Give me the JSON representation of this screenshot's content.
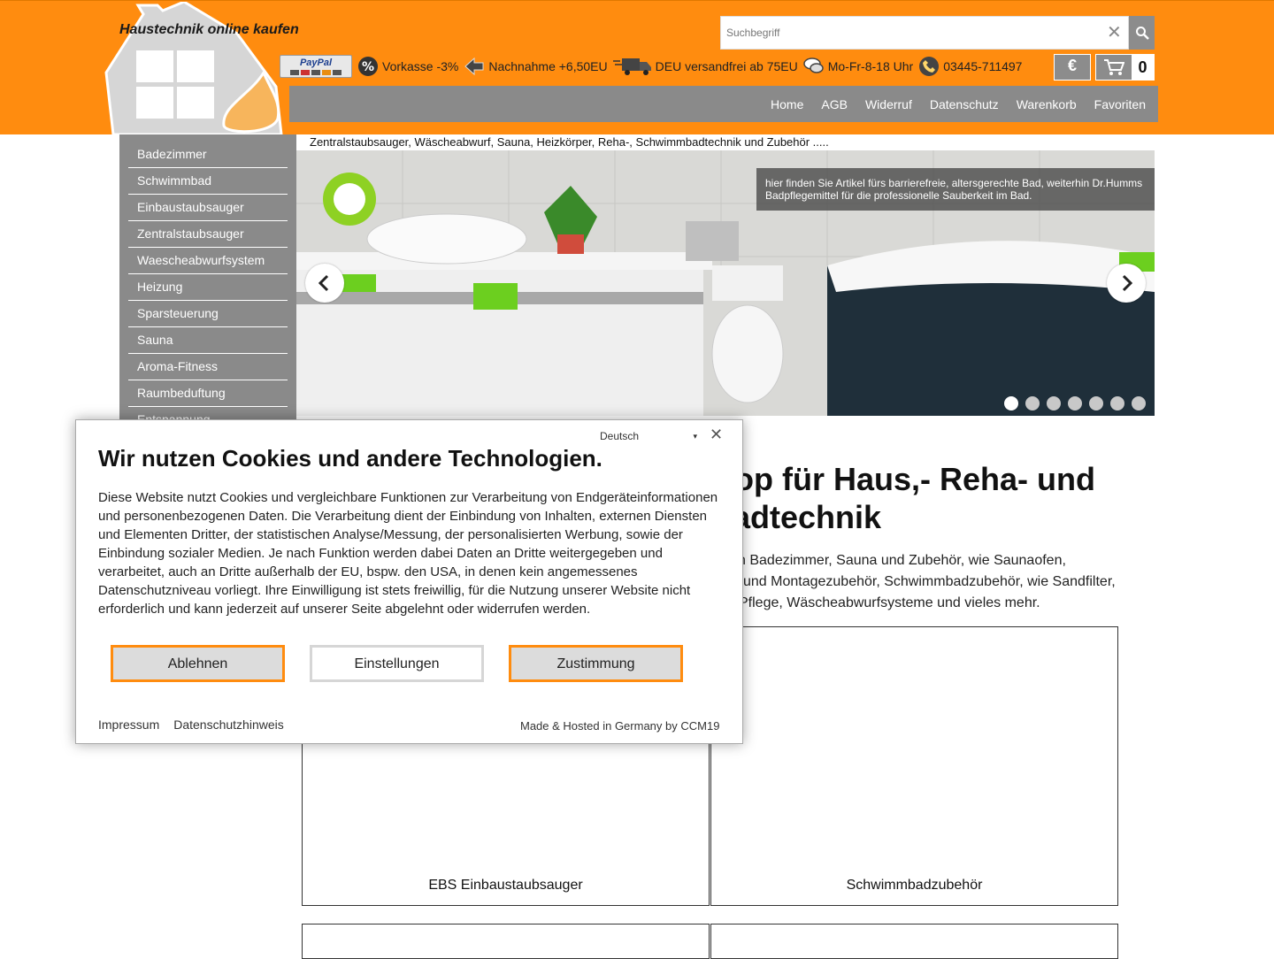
{
  "header": {
    "tagline": "Haustechnik online kaufen",
    "search": {
      "placeholder": "Suchbegriff",
      "value": ""
    },
    "info": [
      {
        "icon": "paypal-logo",
        "text": ""
      },
      {
        "icon": "percent-icon",
        "text": "Vorkasse -3%"
      },
      {
        "icon": "arrow-icon",
        "text": "Nachnahme +6,50EU"
      },
      {
        "icon": "truck-icon",
        "text": "DEU versandfrei ab 75EU"
      },
      {
        "icon": "speech-icon",
        "text": "Mo-Fr-8-18 Uhr"
      },
      {
        "icon": "phone-icon",
        "text": "03445-711497"
      }
    ],
    "paypal_label": "PayPal",
    "currency": "€",
    "cart_count": "0"
  },
  "nav": [
    "Home",
    "AGB",
    "Widerruf",
    "Datenschutz",
    "Warenkorb",
    "Favoriten"
  ],
  "sidebar": [
    "Badezimmer",
    "Schwimmbad",
    "Einbaustaubsauger",
    "Zentralstaubsauger",
    "Waescheabwurfsystem",
    "Heizung",
    "Sparsteuerung",
    "Sauna",
    "Aroma-Fitness",
    "Raumbeduftung",
    "Entspannung"
  ],
  "slogan": "Zentralstaubsauger, Wäscheabwurf, Sauna, Heizkörper, Reha-, Schwimmbadtechnik und Zubehör .....",
  "slider": {
    "caption": "hier finden Sie Artikel fürs barrierefreie, altersgerechte Bad, weiterhin Dr.Humms Badpflegemittel für die professionelle Sauberkeit im Bad.",
    "dot_count": 7,
    "active_dot": 1
  },
  "main": {
    "heading_visible": "op für Haus,- Reha- und adtechnik",
    "heading_line1": "op für Haus,- Reha- und",
    "heading_line2": "adtechnik",
    "intro_line1": "n Badezimmer, Sauna und Zubehör, wie Saunaofen,",
    "intro_line2": "und Montagezubehör, Schwimmbadzubehör, wie Sandfilter,",
    "intro_line3": "Pflege, Wäscheabwurfsysteme und vieles mehr.",
    "products": [
      "EBS Einbaustaubsauger",
      "Schwimmbadzubehör"
    ]
  },
  "cookie": {
    "language": "Deutsch",
    "title": "Wir nutzen Cookies und andere Technologien.",
    "text": "Diese Website nutzt Cookies und vergleichbare Funktionen zur Verarbeitung von Endgeräteinformationen und personenbezogenen Daten. Die Verarbeitung dient der Einbindung von Inhalten, externen Diensten und Elementen Dritter, der statistischen Analyse/Messung, der personalisierten Werbung, sowie der Einbindung sozialer Medien. Je nach Funktion werden dabei Daten an Dritte weitergegeben und verarbeitet, auch an Dritte außerhalb der EU, bspw. den USA, in denen kein angemessenes Datenschutzniveau vorliegt. Ihre Einwilligung ist stets freiwillig, für die Nutzung unserer Website nicht erforderlich und kann jederzeit auf unserer Seite abgelehnt oder widerrufen werden.",
    "reject": "Ablehnen",
    "settings": "Einstellungen",
    "accept": "Zustimmung",
    "links": [
      "Impressum",
      "Datenschutzhinweis"
    ],
    "made_by": "Made & Hosted in Germany by CCM19"
  },
  "colors": {
    "brand_orange": "#ff8c0f",
    "nav_gray": "#8a8a8a"
  }
}
